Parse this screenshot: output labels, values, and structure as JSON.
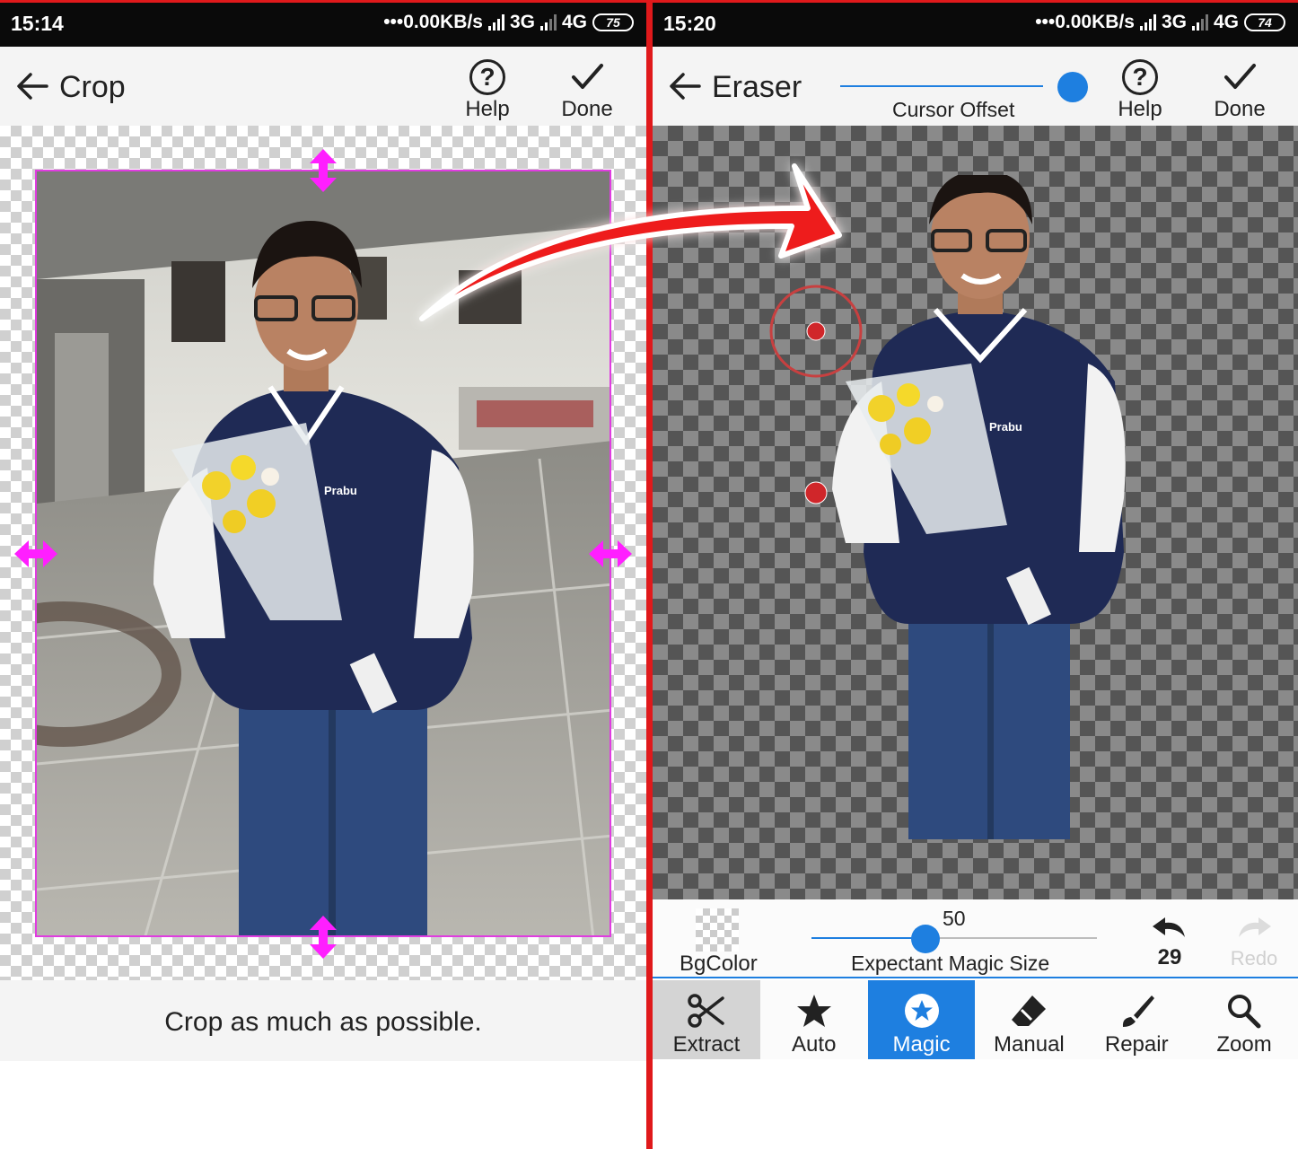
{
  "left": {
    "status": {
      "time": "15:14",
      "speed": "•••0.00KB/s",
      "net1": "3G",
      "net2": "4G",
      "battery": "75"
    },
    "toolbar": {
      "title": "Crop",
      "help_label": "Help",
      "done_label": "Done"
    },
    "hint": "Crop as much as possible."
  },
  "right": {
    "status": {
      "time": "15:20",
      "speed": "•••0.00KB/s",
      "net1": "3G",
      "net2": "4G",
      "battery": "74"
    },
    "toolbar": {
      "title": "Eraser",
      "offset_label": "Cursor Offset",
      "help_label": "Help",
      "done_label": "Done"
    },
    "controls": {
      "bgcolor_label": "BgColor",
      "magic_size_label": "Expectant Magic Size",
      "magic_size_value": "50",
      "magic_size_fraction": 0.4,
      "undo_count": "29",
      "redo_label": "Redo"
    },
    "tabs": [
      {
        "label": "Extract",
        "icon": "scissors-icon"
      },
      {
        "label": "Auto",
        "icon": "star-icon"
      },
      {
        "label": "Magic",
        "icon": "magic-star-icon"
      },
      {
        "label": "Manual",
        "icon": "eraser-icon"
      },
      {
        "label": "Repair",
        "icon": "brush-icon"
      },
      {
        "label": "Zoom",
        "icon": "search-icon"
      }
    ],
    "active_tab": "Magic"
  },
  "photo_badge": "Prabu",
  "colors": {
    "accent": "#1e7fe0",
    "crop_frame": "#e03ce0",
    "divider": "#e0191b"
  }
}
